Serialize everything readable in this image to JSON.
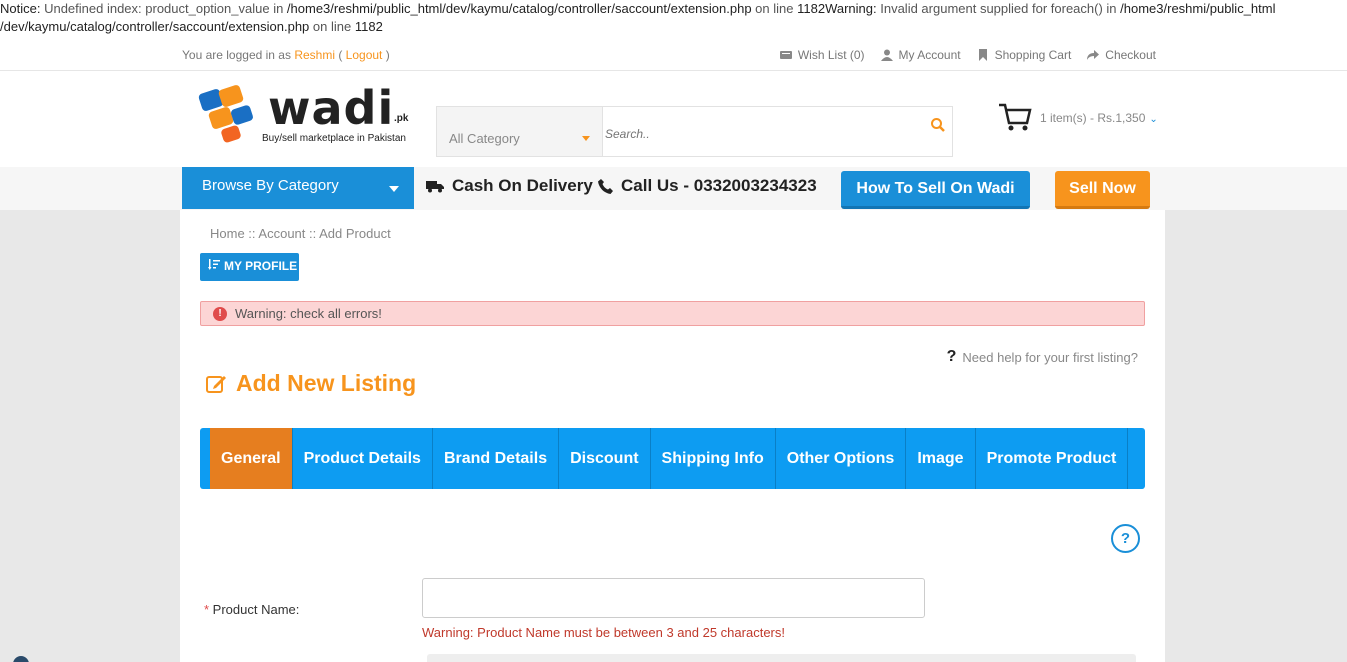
{
  "notice": {
    "line1_label": "Notice: ",
    "line1_msg": "Undefined index: product_option_value in ",
    "line1_path": "/home3/reshmi/public_html/dev/kaymu/catalog/controller/saccount/extension.php",
    "line1_on": " on line ",
    "line1_num": "1182",
    "line1_warn": "Warning: ",
    "line1_warnmsg": "Invalid argument supplied for foreach() in ",
    "line1_path2": "/home3/reshmi/public_html",
    "line2_path": "/dev/kaymu/catalog/controller/saccount/extension.php",
    "line2_on": " on line ",
    "line2_num": "1182"
  },
  "topbar": {
    "logged_prefix": "You are logged in as ",
    "user": "Reshmi",
    "logout_open": " ( ",
    "logout": "Logout",
    "logout_close": " )",
    "links": {
      "wishlist": "Wish List (0)",
      "account": "My Account",
      "cart": "Shopping Cart",
      "checkout": "Checkout"
    }
  },
  "header": {
    "logo_word": "wadi",
    "logo_pk": ".pk",
    "logo_tagline": "Buy/sell marketplace in Pakistan",
    "category_value": "All Category",
    "search_placeholder": "Search..",
    "cart_text": "1 item(s) - Rs.1,350"
  },
  "nav": {
    "browse": "Browse By Category",
    "cod": "Cash On Delivery",
    "call": "Call Us - 0332003234323",
    "howto": "How To Sell On Wadi",
    "sell": "Sell Now"
  },
  "page": {
    "breadcrumb": {
      "home": "Home",
      "sep": " :: ",
      "account": "Account",
      "add": "Add Product"
    },
    "profile_btn": "MY PROFILE",
    "alert": "Warning: check all errors!",
    "help_link": "Need help for your first listing?",
    "title": "Add New Listing",
    "tabs": [
      "General",
      "Product Details",
      "Brand Details",
      "Discount",
      "Shipping Info",
      "Other Options",
      "Image",
      "Promote Product"
    ],
    "active_tab": "General",
    "form": {
      "product_name_req": "*",
      "product_name_label": " Product Name:",
      "product_name_value": "",
      "product_name_error": "Warning: Product Name must be between 3 and 25 characters!"
    }
  },
  "colors": {
    "brand_blue": "#1a8fd8",
    "tab_blue": "#0d9cf2",
    "orange": "#f7941d",
    "active_tab": "#e67e1f",
    "alert_bg": "#fcd5d5",
    "error_text": "#c0392b"
  },
  "icons": {
    "wishlist": "list-icon",
    "account": "user-icon",
    "cart": "bookmark-icon",
    "checkout": "share-icon",
    "search": "search-icon",
    "header_cart": "cart-icon",
    "truck": "truck-icon",
    "phone": "phone-icon",
    "profile": "sort-icon",
    "alert": "exclamation-circle-icon",
    "help": "question-icon",
    "title": "edit-icon"
  }
}
